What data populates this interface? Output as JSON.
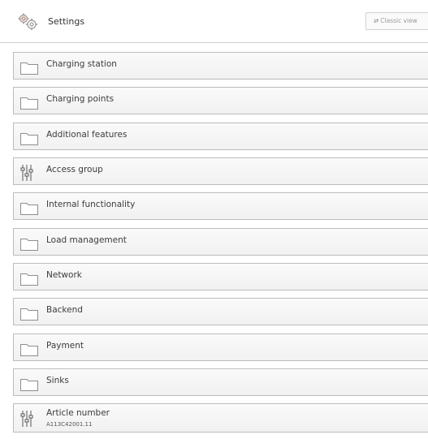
{
  "header": {
    "title": "Settings",
    "icon": "gears-icon",
    "classic_view_label": "Classic view"
  },
  "colors": {
    "border": "#bcbcbc",
    "row_bg": "#f4f4f4",
    "text": "#3c3c3c"
  },
  "items": [
    {
      "label": "Charging station",
      "icon": "folder-icon"
    },
    {
      "label": "Charging points",
      "icon": "folder-icon"
    },
    {
      "label": "Additional features",
      "icon": "folder-icon"
    },
    {
      "label": "Access group",
      "icon": "sliders-icon"
    },
    {
      "label": "Internal functionality",
      "icon": "folder-icon"
    },
    {
      "label": "Load management",
      "icon": "folder-icon"
    },
    {
      "label": "Network",
      "icon": "folder-icon"
    },
    {
      "label": "Backend",
      "icon": "folder-icon"
    },
    {
      "label": "Payment",
      "icon": "folder-icon"
    },
    {
      "label": "Sinks",
      "icon": "folder-icon"
    },
    {
      "label": "Article number",
      "value": "A113C42001.11",
      "icon": "sliders-icon"
    }
  ]
}
